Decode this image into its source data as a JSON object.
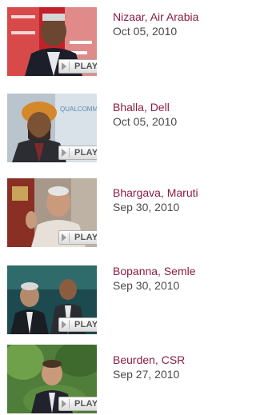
{
  "videos": [
    {
      "title": "Nizaar, Air Arabia",
      "date": "Oct 05, 2010",
      "play_label": "PLAY"
    },
    {
      "title": "Bhalla, Dell",
      "date": "Oct 05, 2010",
      "play_label": "PLAY"
    },
    {
      "title": "Bhargava, Maruti",
      "date": "Sep 30, 2010",
      "play_label": "PLAY"
    },
    {
      "title": "Bopanna, Semle",
      "date": "Sep 30, 2010",
      "play_label": "PLAY"
    },
    {
      "title": "Beurden, CSR",
      "date": "Sep 27, 2010",
      "play_label": "PLAY"
    }
  ],
  "colors": {
    "title_link": "#8b1e3f",
    "date_text": "#4a4a4a"
  },
  "icons": [
    "play-icon"
  ]
}
